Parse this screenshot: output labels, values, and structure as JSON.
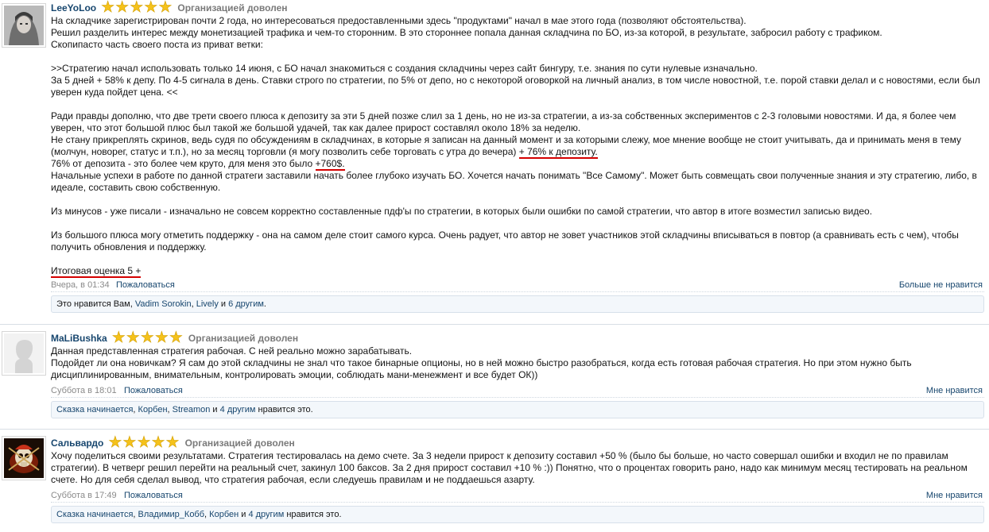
{
  "posts": [
    {
      "username": "LeeYoLoo",
      "rating_label": "Организацией доволен",
      "stars": 5,
      "paragraphs": [
        "На складчике зарегистрирован почти 2 года, но интересоваться предоставленными здесь \"продуктами\" начал в мае этого года (позволяют обстоятельства).",
        "Решил разделить интерес между монетизацией трафика и чем-то сторонним. В это стороннее попала данная складчина по БО, из-за которой, в результате, забросил работу с трафиком.",
        "Скопипасто часть своего поста из приват ветки:",
        "",
        ">>Стратегию начал использовать только 14 июня, с БО начал знакомиться с создания складчины через сайт бингуру, т.е. знания по сути нулевые изначально.",
        "За 5 дней + 58% к депу. По 4-5 сигнала в день. Ставки строго по стратегии, по 5% от депо, но с некоторой оговоркой на личный анализ, в том числе новостной, т.е. порой ставки делал и с новостями, если был уверен куда пойдет цена. <<",
        "",
        "Ради правды дополню, что две трети своего плюса к депозиту за эти 5 дней позже слил за 1 день, но не из-за стратегии, а из-за собственных экспериментов с 2-3 головыми новостями. И да, я более чем уверен, что этот большой плюс был такой же большой удачей, так как далее прирост составлял около 18% за неделю.",
        "Не стану прикреплять скринов, ведь судя по обсуждениям в складчинах, в которые я записан на данный момент и за которыми слежу, мое мнение вообще не стоит учитывать, да и принимать меня в тему (молчун, новорег, статус и т.п.), но за месяц торговли (я могу позволить себе торговать с утра до вечера) ",
        "+ 76% к депозиту.",
        "76% от депозита - это более чем круто, для меня это было ",
        "+760$.",
        "Начальные успехи в работе по данной стратеги заставили начать более глубоко изучать БО. Хочется начать понимать \"Все Самому\". Может быть совмещать свои полученные знания и эту стратегию, либо, в идеале, составить свою собственную.",
        "",
        "Из минусов - уже писали - изначально не совсем корректно составленные пдф'ы по стратегии, в которых были ошибки по самой стратегии, что автор в итоге возместил записью видео.",
        "",
        "Из большого плюса могу отметить поддержку - она на самом деле стоит самого курса. Очень радует, что автор не зовет участников этой складчины вписываться в повтор (а сравнивать есть с чем), чтобы получить обновления и поддержку.",
        "",
        "Итоговая оценка 5 +"
      ],
      "date": "Вчера, в 01:34",
      "report": "Пожаловаться",
      "like_action": "Больше не нравится",
      "likes": {
        "prefix": "Это нравится Вам, ",
        "names": [
          "Vadim Sorokin",
          "Lively"
        ],
        "and": " и ",
        "others": "6 другим",
        "suffix": "."
      }
    },
    {
      "username": "MaLiBushka",
      "rating_label": "Организацией доволен",
      "stars": 5,
      "paragraphs": [
        "Данная представленная стратегия рабочая. С ней реально можно зарабатывать.",
        "Подойдет ли она новичкам? Я сам до этой складчины не знал что такое бинарные опционы, но в ней можно быстро разобраться, когда есть готовая рабочая стратегия. Но при этом нужно быть дисциплинированным, внимательным, контролировать эмоции, соблюдать мани-менежмент и все будет ОК))"
      ],
      "date": "Суббота в 18:01",
      "report": "Пожаловаться",
      "like_action": "Мне нравится",
      "likes": {
        "prefix": "",
        "names": [
          "Сказка начинается",
          "Корбен",
          "Streamon"
        ],
        "and": " и ",
        "others": "4 другим",
        "suffix": " нравится это."
      }
    },
    {
      "username": "Сальвардо",
      "rating_label": "Организацией доволен",
      "stars": 5,
      "paragraphs": [
        "Хочу поделиться своими результатами. Стратегия тестировалась на демо счете. За 3 недели прирост к депозиту составил +50 % (было бы больше, но часто совершал ошибки и входил не по правилам стратегии). В четверг решил перейти на реальный счет, закинул 100 баксов. За 2 дня прирост составил +10 % :)) Понятно, что о процентах говорить рано, надо как минимум месяц тестировать на реальном счете. Но для себя сделал вывод, что стратегия рабочая, если следуешь правилам и не поддаешься азарту."
      ],
      "date": "Суббота в 17:49",
      "report": "Пожаловаться",
      "like_action": "Мне нравится",
      "likes": {
        "prefix": "",
        "names": [
          "Сказка начинается",
          "Владимир_Кобб",
          "Корбен"
        ],
        "and": " и ",
        "others": "4 другим",
        "suffix": " нравится это."
      }
    }
  ],
  "colors": {
    "link": "#17466e",
    "star": "#f5c21b",
    "annotation": "#d40000",
    "muted": "#8a8a8a"
  }
}
